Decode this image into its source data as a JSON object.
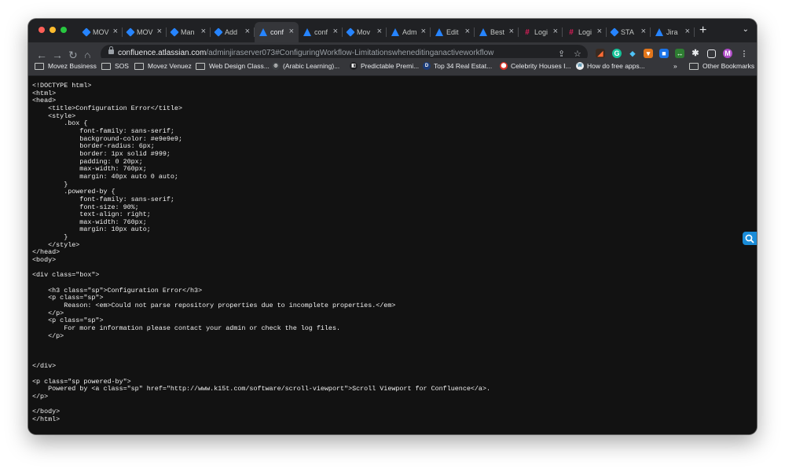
{
  "browser": {
    "tabs": [
      {
        "label": "MOV",
        "icon": "jira-diamond-icon",
        "active": false
      },
      {
        "label": "MOV",
        "icon": "jira-diamond-icon",
        "active": false
      },
      {
        "label": "Man",
        "icon": "jira-diamond-icon",
        "active": false
      },
      {
        "label": "Add",
        "icon": "jira-diamond-icon",
        "active": false
      },
      {
        "label": "conf",
        "icon": "atlassian-icon",
        "active": true
      },
      {
        "label": "conf",
        "icon": "atlassian-icon",
        "active": false
      },
      {
        "label": "Mov",
        "icon": "jira-diamond-icon",
        "active": false
      },
      {
        "label": "Adm",
        "icon": "atlassian-icon",
        "active": false
      },
      {
        "label": "Edit",
        "icon": "atlassian-icon",
        "active": false
      },
      {
        "label": "Best",
        "icon": "atlassian-icon",
        "active": false
      },
      {
        "label": "Logi",
        "icon": "slack-icon",
        "active": false
      },
      {
        "label": "Logi",
        "icon": "slack-icon",
        "active": false
      },
      {
        "label": "STA",
        "icon": "jira-diamond-icon",
        "active": false
      },
      {
        "label": "Jira",
        "icon": "atlassian-icon",
        "active": false
      }
    ],
    "new_tab": "+",
    "url_host": "confluence.atlassian.com",
    "url_path": "/adminjiraserver073#ConfiguringWorkflow-Limitationswheneditinganactiveworkflow",
    "bookmarks": [
      {
        "label": "Movez Business",
        "icon": "folder-icon"
      },
      {
        "label": "SOS",
        "icon": "folder-icon"
      },
      {
        "label": "Movez Venuez",
        "icon": "folder-icon"
      },
      {
        "label": "Web Design Class...",
        "icon": "folder-icon"
      },
      {
        "label": "(Arabic Learning)...",
        "icon": "globe-icon"
      },
      {
        "label": "Predictable Premi...",
        "icon": "page-icon"
      },
      {
        "label": "Top 34 Real Estat...",
        "icon": "d-badge-icon"
      },
      {
        "label": "Celebrity Houses I...",
        "icon": "pin-icon"
      },
      {
        "label": "How do free apps...",
        "icon": "wordpress-icon"
      }
    ],
    "bookmarks_overflow": "»",
    "other_bookmarks": "Other Bookmarks"
  },
  "page": {
    "source": "<!DOCTYPE html>\n<html>\n<head>\n    <title>Configuration Error</title>\n    <style>\n        .box {\n            font-family: sans-serif;\n            background-color: #e9e9e9;\n            border-radius: 6px;\n            border: 1px solid #999;\n            padding: 0 20px;\n            max-width: 760px;\n            margin: 40px auto 0 auto;\n        }\n        .powered-by {\n            font-family: sans-serif;\n            font-size: 90%;\n            text-align: right;\n            max-width: 760px;\n            margin: 10px auto;\n        }\n    </style>\n</head>\n<body>\n\n<div class=\"box\">\n\n    <h3 class=\"sp\">Configuration Error</h3>\n    <p class=\"sp\">\n        Reason: <em>Could not parse repository properties due to incomplete properties.</em>\n    </p>\n    <p class=\"sp\">\n        For more information please contact your admin or check the log files.\n    </p>\n\n\n\n</div>\n\n<p class=\"sp powered-by\">\n    Powered by <a class=\"sp\" href=\"http://www.k15t.com/software/scroll-viewport\">Scroll Viewport for Confluence</a>.\n</p>\n\n</body>\n</html>"
  }
}
